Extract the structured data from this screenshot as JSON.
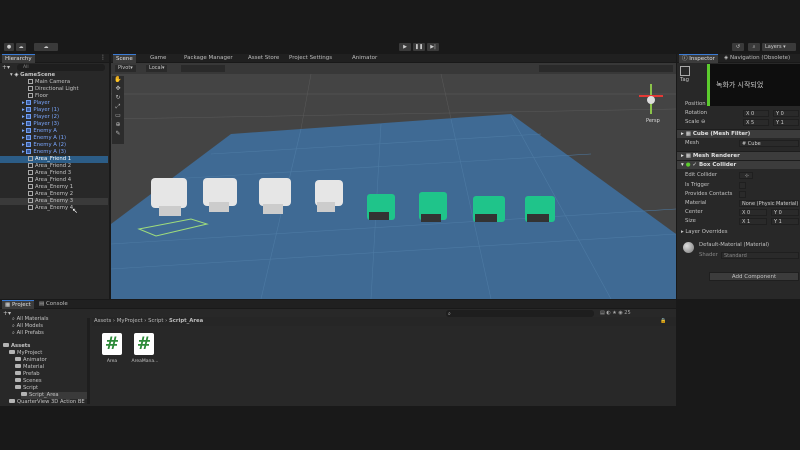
{
  "toolbar": {
    "account_label": "",
    "layers_label": "Layers",
    "play_icon": "play-icon",
    "pause_icon": "pause-icon",
    "step_icon": "step-icon"
  },
  "hierarchy": {
    "tab": "Hierarchy",
    "search_placeholder": "All",
    "scene": "GameScene",
    "items": [
      {
        "label": "Main Camera",
        "type": "obj"
      },
      {
        "label": "Directional Light",
        "type": "obj"
      },
      {
        "label": "Floor",
        "type": "obj"
      },
      {
        "label": "Player",
        "type": "prefab"
      },
      {
        "label": "Player (1)",
        "type": "prefab"
      },
      {
        "label": "Player (2)",
        "type": "prefab"
      },
      {
        "label": "Player (3)",
        "type": "prefab"
      },
      {
        "label": "Enemy A",
        "type": "prefab"
      },
      {
        "label": "Enemy A (1)",
        "type": "prefab"
      },
      {
        "label": "Enemy A (2)",
        "type": "prefab"
      },
      {
        "label": "Enemy A (3)",
        "type": "prefab"
      },
      {
        "label": "Area_Friend 1",
        "type": "sel"
      },
      {
        "label": "Area_Friend 2",
        "type": "obj"
      },
      {
        "label": "Area_Friend 3",
        "type": "obj"
      },
      {
        "label": "Area_Friend 4",
        "type": "obj"
      },
      {
        "label": "Area_Enemy 1",
        "type": "obj"
      },
      {
        "label": "Area_Enemy 2",
        "type": "obj"
      },
      {
        "label": "Area_Enemy 3",
        "type": "hov"
      },
      {
        "label": "Area_Enemy 4",
        "type": "obj"
      }
    ]
  },
  "scene": {
    "tabs": [
      "Scene",
      "Game",
      "Package Manager",
      "Asset Store",
      "Project Settings",
      "Animator"
    ],
    "pivot_label": "Pivot",
    "local_label": "Local",
    "persp_label": "Persp",
    "tool_icons": [
      "hand-icon",
      "move-icon",
      "rotate-icon",
      "scale-icon",
      "rect-icon",
      "transform-icon",
      "custom-icon"
    ]
  },
  "inspector": {
    "tabs": [
      "Inspector",
      "Navigation (Obsolete)"
    ],
    "tag_label": "Tag",
    "overlay_text": "녹화가 시작되었",
    "position_label": "Position",
    "rotation": {
      "label": "Rotation",
      "x": "0",
      "y": "0"
    },
    "scale": {
      "label": "Scale",
      "x": "5",
      "y": "1"
    },
    "mesh_filter": {
      "title": "Cube (Mesh Filter)",
      "mesh_label": "Mesh",
      "mesh_value": "Cube"
    },
    "mesh_renderer": "Mesh Renderer",
    "box_collider": {
      "title": "Box Collider",
      "edit_label": "Edit Collider",
      "trigger_label": "Is Trigger",
      "contacts_label": "Provides Contacts",
      "material_label": "Material",
      "material_value": "None (Physic Material)",
      "center_label": "Center",
      "center_x": "0",
      "center_y": "0",
      "size_label": "Size",
      "size_x": "1",
      "size_y": "1"
    },
    "layer_overrides": "Layer Overrides",
    "material": {
      "name": "Default-Material (Material)",
      "shader_label": "Shader",
      "shader_value": "Standard"
    },
    "add_component": "Add Component"
  },
  "project": {
    "tabs": [
      "Project",
      "Console"
    ],
    "favorites": [
      "All Materials",
      "All Models",
      "All Prefabs"
    ],
    "tree": [
      {
        "label": "Assets",
        "depth": 0
      },
      {
        "label": "MyProject",
        "depth": 1
      },
      {
        "label": "Animator",
        "depth": 2
      },
      {
        "label": "Material",
        "depth": 2
      },
      {
        "label": "Prefab",
        "depth": 2
      },
      {
        "label": "Scenes",
        "depth": 2
      },
      {
        "label": "Script",
        "depth": 2
      },
      {
        "label": "Script_Area",
        "depth": 3
      },
      {
        "label": "QuarterView 3D Action BE",
        "depth": 1
      }
    ],
    "breadcrumb": [
      "Assets",
      "MyProject",
      "Script",
      "Script_Area"
    ],
    "files": [
      "Area",
      "AreaMana..."
    ],
    "count_label": "25"
  },
  "colors": {
    "selection": "#2c5d87",
    "accent": "#3a7bd5",
    "ground": "#3f6a94"
  }
}
